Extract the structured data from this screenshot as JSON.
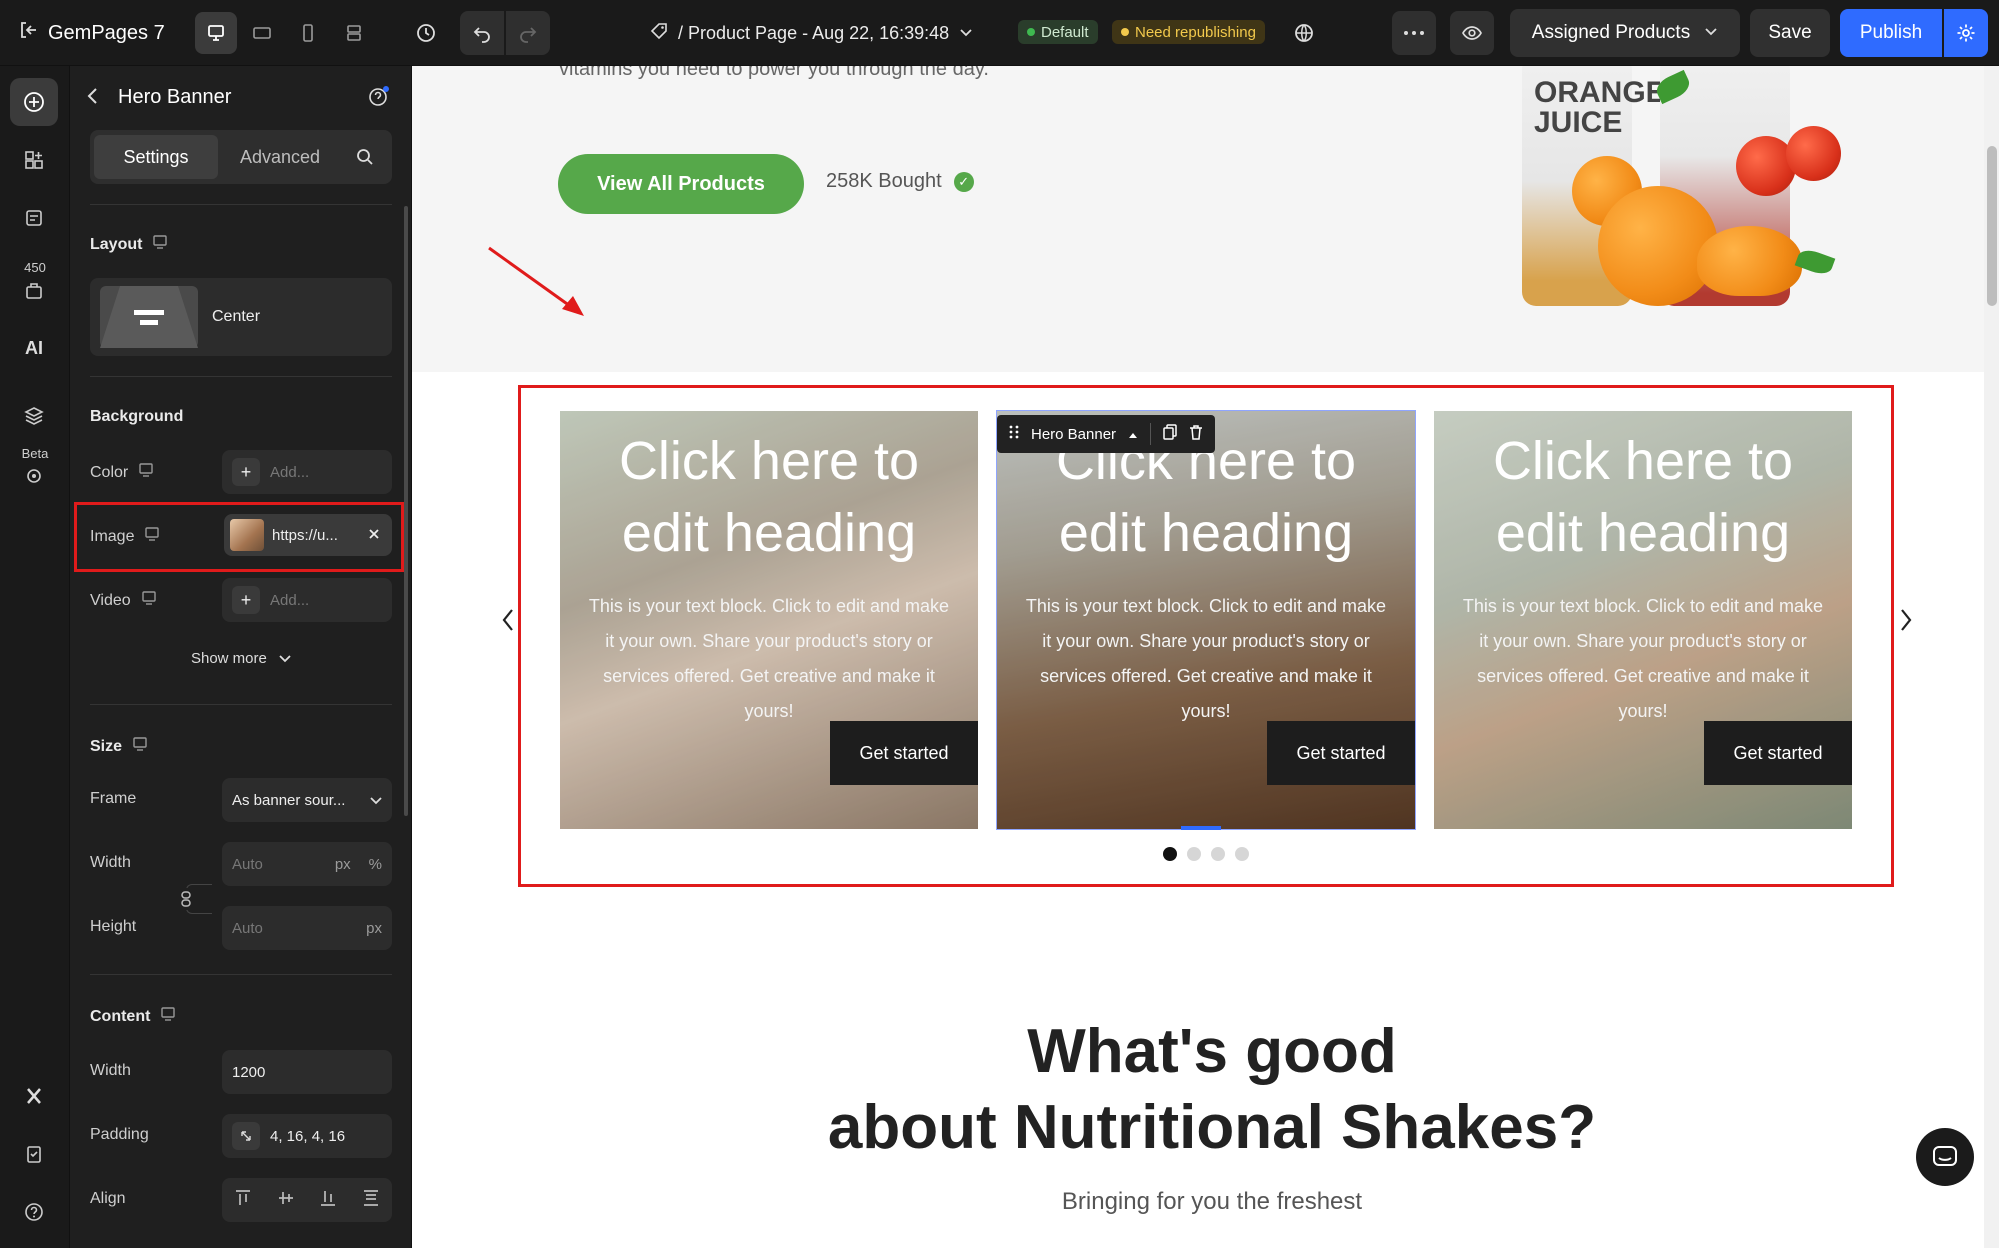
{
  "topbar": {
    "brand": "GemPages 7",
    "page_title": "/ Product Page - Aug 22, 16:39:48",
    "badge_default": "Default",
    "badge_need": "Need republishing",
    "assigned": "Assigned Products",
    "save": "Save",
    "publish": "Publish"
  },
  "rail": {
    "count_badge": "450",
    "beta": "Beta"
  },
  "panel": {
    "title": "Hero Banner",
    "tabs": [
      "Settings",
      "Advanced"
    ],
    "layout": {
      "label": "Layout",
      "value": "Center"
    },
    "background": {
      "label": "Background",
      "color_label": "Color",
      "color_placeholder": "Add...",
      "image_label": "Image",
      "image_value": "https://u...",
      "video_label": "Video",
      "video_placeholder": "Add...",
      "show_more": "Show more"
    },
    "size": {
      "label": "Size",
      "frame_label": "Frame",
      "frame_value": "As banner sour...",
      "width_label": "Width",
      "width_placeholder": "Auto",
      "width_unit_px": "px",
      "width_unit_pct": "%",
      "height_label": "Height",
      "height_placeholder": "Auto",
      "height_unit": "px"
    },
    "content": {
      "label": "Content",
      "width_label": "Width",
      "width_value": "1200",
      "padding_label": "Padding",
      "padding_value": "4, 16, 4, 16",
      "align_label": "Align"
    }
  },
  "canvas": {
    "vitamins_text": "vitamins you need to power you through the day.",
    "view_all": "View All Products",
    "bought": "258K Bought",
    "juice_label": "ORANGE JUICE",
    "selected_chip": "Hero Banner",
    "cards": [
      {
        "heading": "Click here to edit heading",
        "text": "This is your text block. Click to edit and make it your own. Share your product's story or services offered. Get creative and make it yours!",
        "button": "Get started"
      },
      {
        "heading": "Click here to edit heading",
        "text": "This is your text block. Click to edit and make it your own. Share your product's story or services offered. Get creative and make it yours!",
        "button": "Get started"
      },
      {
        "heading": "Click here to edit heading",
        "text": "This is your text block. Click to edit and make it your own. Share your product's story or services offered. Get creative and make it yours!",
        "button": "Get started"
      }
    ],
    "slider_dots": 4,
    "active_dot": 1,
    "section_heading_1": "What's good",
    "section_heading_2": "about Nutritional Shakes?",
    "section_sub": "Bringing for you the freshest"
  },
  "colors": {
    "accent": "#2f6bff",
    "highlight": "#e01b1b",
    "green": "#56a84a"
  }
}
